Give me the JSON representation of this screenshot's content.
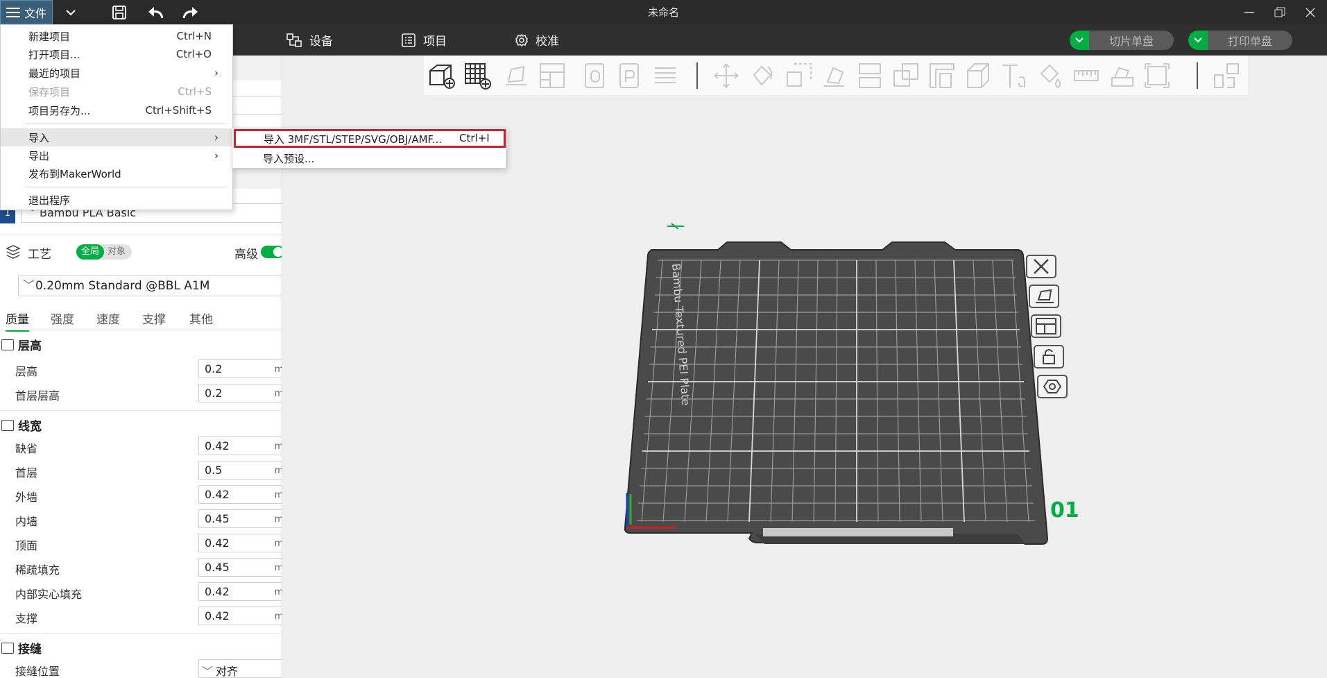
{
  "titlebar": {
    "file_label": "文件",
    "title": "未命名",
    "icons": [
      "menu-icon",
      "chevron-down-icon",
      "save-icon",
      "undo-icon",
      "redo-icon"
    ],
    "window_controls": [
      "minimize-icon",
      "restore-icon",
      "close-icon"
    ]
  },
  "navbar": {
    "tabs": [
      {
        "label": "设备",
        "icon": "device-icon"
      },
      {
        "label": "项目",
        "icon": "project-icon"
      },
      {
        "label": "校准",
        "icon": "calibrate-icon"
      }
    ],
    "slice_button": "切片单盘",
    "print_button": "打印单盘",
    "accent": "#00ae42"
  },
  "file_menu": {
    "items": [
      {
        "label": "新建项目",
        "shortcut": "Ctrl+N"
      },
      {
        "label": "打开项目...",
        "shortcut": "Ctrl+O"
      },
      {
        "label": "最近的项目",
        "submenu": true
      },
      {
        "label": "保存项目",
        "shortcut": "Ctrl+S",
        "disabled": true
      },
      {
        "label": "项目另存为...",
        "shortcut": "Ctrl+Shift+S"
      },
      {
        "label": "导入",
        "submenu": true
      },
      {
        "label": "导出",
        "submenu": true
      },
      {
        "label": "发布到MakerWorld"
      },
      {
        "label": "退出程序"
      }
    ],
    "arrow": "›"
  },
  "import_submenu": {
    "items": [
      {
        "label": "导入 3MF/STL/STEP/SVG/OBJ/AMF...",
        "shortcut": "Ctrl+I"
      },
      {
        "label": "导入预设..."
      }
    ]
  },
  "left_panel": {
    "filament": {
      "index": "1",
      "name": "Bambu PLA Basic"
    },
    "process": {
      "title": "工艺",
      "global": "全局",
      "object": "对象",
      "advanced": "高级",
      "preset": "0.20mm Standard @BBL A1M"
    },
    "tabs": [
      "质量",
      "强度",
      "速度",
      "支撑",
      "其他"
    ],
    "sections": [
      {
        "title": "层高",
        "params": [
          {
            "label": "层高",
            "value": "0.2",
            "unit": "mm"
          },
          {
            "label": "首层层高",
            "value": "0.2",
            "unit": "mm"
          }
        ]
      },
      {
        "title": "线宽",
        "params": [
          {
            "label": "缺省",
            "value": "0.42",
            "unit": "mm"
          },
          {
            "label": "首层",
            "value": "0.5",
            "unit": "mm"
          },
          {
            "label": "外墙",
            "value": "0.42",
            "unit": "mm"
          },
          {
            "label": "内墙",
            "value": "0.45",
            "unit": "mm"
          },
          {
            "label": "顶面",
            "value": "0.42",
            "unit": "mm"
          },
          {
            "label": "稀疏填充",
            "value": "0.45",
            "unit": "mm"
          },
          {
            "label": "内部实心填充",
            "value": "0.42",
            "unit": "mm"
          },
          {
            "label": "支撑",
            "value": "0.42",
            "unit": "mm"
          }
        ]
      },
      {
        "title": "接缝",
        "params": [
          {
            "label": "接缝位置",
            "value": "对齐",
            "unit": ""
          }
        ]
      }
    ]
  },
  "plate": {
    "texture_text": "Bambu Textured PEI Plate",
    "number": "01"
  }
}
